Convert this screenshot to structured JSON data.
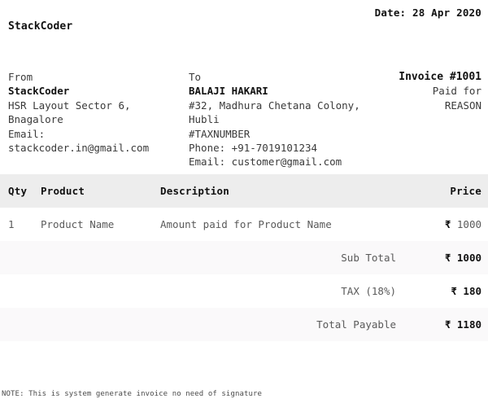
{
  "header": {
    "date_label": "Date: 28 Apr 2020",
    "brand": "StackCoder"
  },
  "from": {
    "label": "From",
    "name": "StackCoder",
    "address_line1": "HSR Layout Sector 6,",
    "address_line2": "Bnagalore",
    "email_label": "Email:",
    "email": "stackcoder.in@gmail.com"
  },
  "to": {
    "label": "To",
    "name": "BALAJI HAKARI",
    "address_line1": "#32, Madhura Chetana Colony,",
    "address_line2": "Hubli",
    "tax_number": "#TAXNUMBER",
    "phone": "Phone: +91-7019101234",
    "email": "Email: customer@gmail.com"
  },
  "meta": {
    "invoice_number": "Invoice #1001",
    "paid_for_label": "Paid for",
    "reason": "REASON"
  },
  "table": {
    "columns": [
      "Qty",
      "Product",
      "Description",
      "Price"
    ],
    "rows": [
      {
        "qty": "1",
        "product": "Product Name",
        "description": "Amount paid for Product Name",
        "currency": "₹",
        "price": "1000"
      }
    ],
    "totals": [
      {
        "label": "Sub Total",
        "currency": "₹",
        "amount": "1000"
      },
      {
        "label": "TAX (18%)",
        "currency": "₹",
        "amount": "180"
      },
      {
        "label": "Total Payable",
        "currency": "₹",
        "amount": "1180"
      }
    ]
  },
  "footer": {
    "note": "NOTE: This is system generate invoice no need of signature"
  },
  "colors": {
    "header_row_bg": "#ededed",
    "shaded_row_bg": "#faf9fa",
    "page_bg": "#ffffff",
    "text_primary": "#111111",
    "text_secondary": "#5a5a5a"
  }
}
